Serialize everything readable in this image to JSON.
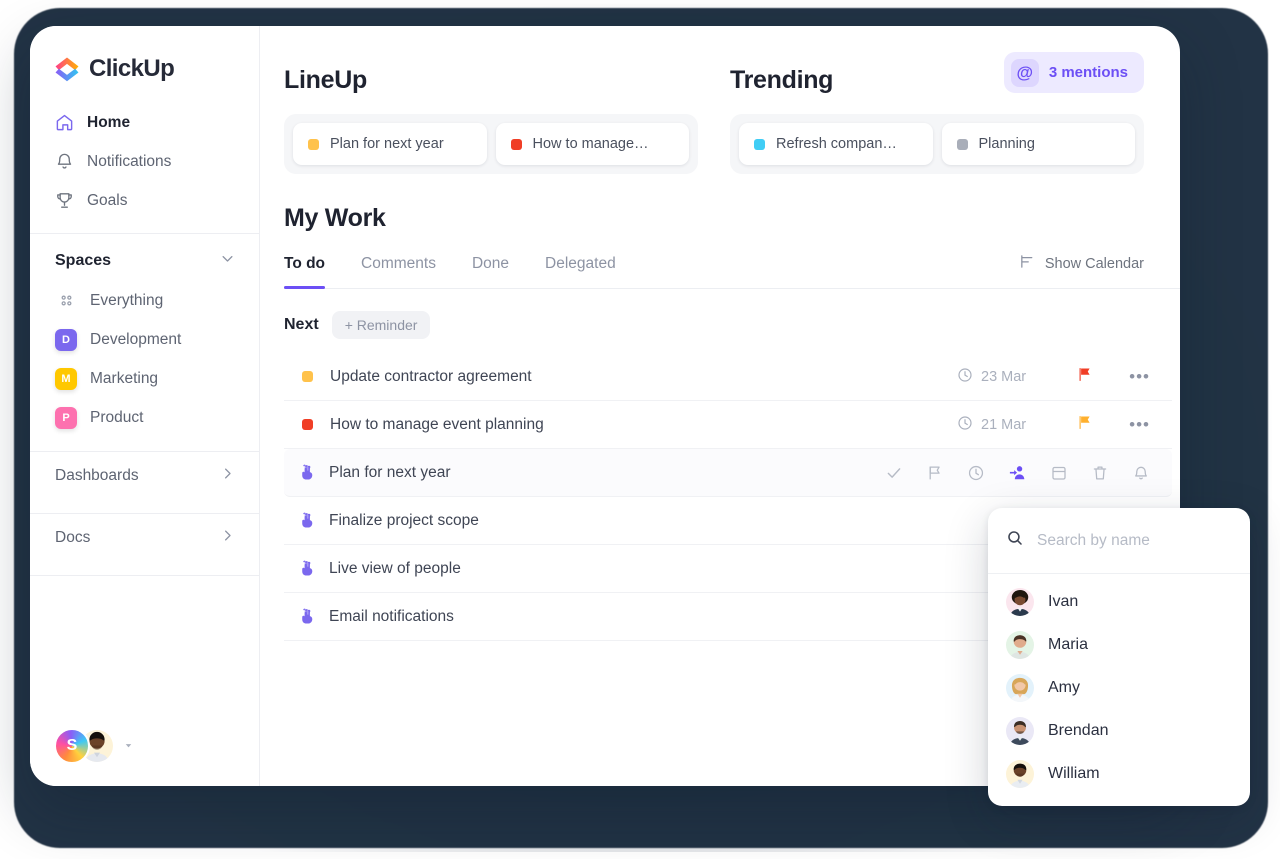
{
  "sidebar": {
    "brand": "ClickUp",
    "nav": [
      {
        "label": "Home",
        "icon": "home-icon",
        "active": true
      },
      {
        "label": "Notifications",
        "icon": "bell-icon",
        "active": false
      },
      {
        "label": "Goals",
        "icon": "trophy-icon",
        "active": false
      }
    ],
    "spaces_title": "Spaces",
    "spaces": [
      {
        "label": "Everything",
        "badge": "",
        "color": "",
        "icon": "grid-icon"
      },
      {
        "label": "Development",
        "badge": "D",
        "color": "#7b68ee"
      },
      {
        "label": "Marketing",
        "badge": "M",
        "color": "#ffc800"
      },
      {
        "label": "Product",
        "badge": "P",
        "color": "#fd71af"
      }
    ],
    "footer": [
      {
        "label": "Dashboards",
        "icon": "chevron-right-icon"
      },
      {
        "label": "Docs",
        "icon": "chevron-right-icon"
      }
    ],
    "user": {
      "initial": "S"
    }
  },
  "lineup": {
    "title": "LineUp",
    "items": [
      {
        "label": "Plan for next year",
        "color": "#ffc24b"
      },
      {
        "label": "How to manage…",
        "color": "#f03e26"
      }
    ]
  },
  "trending": {
    "title": "Trending",
    "items": [
      {
        "label": "Refresh compan…",
        "color": "#40cdf5"
      },
      {
        "label": "Planning",
        "color": "#a9aeb9"
      }
    ]
  },
  "mentions": {
    "icon": "at-icon",
    "label": "3 mentions",
    "color": "#6c4ff5"
  },
  "my_work": {
    "title": "My Work",
    "tabs": [
      {
        "label": "To do",
        "active": true
      },
      {
        "label": "Comments",
        "active": false
      },
      {
        "label": "Done",
        "active": false
      },
      {
        "label": "Delegated",
        "active": false
      }
    ],
    "show_calendar": {
      "label": "Show Calendar",
      "icon": "calendar-toggle-icon"
    },
    "group_label": "Next",
    "reminder_button": "+ Reminder",
    "tasks": [
      {
        "name": "Update contractor agreement",
        "marker": "square",
        "color": "#ffc24b",
        "due": "23 Mar",
        "due_icon": "clock-icon",
        "flag": "flag-icon",
        "flag_color": "#f03e26",
        "more": "•••",
        "hover": false
      },
      {
        "name": "How to manage event planning",
        "marker": "square",
        "color": "#f03e26",
        "due": "21 Mar",
        "due_icon": "clock-icon",
        "flag": "flag-icon",
        "flag_color": "#ffb02e",
        "more": "•••",
        "hover": false
      },
      {
        "name": "Plan for next year",
        "marker": "hand",
        "color": "#7b68ee",
        "due": "",
        "flag": "",
        "hover": true,
        "actions": [
          {
            "icon": "check-icon",
            "active": false
          },
          {
            "icon": "flag-icon",
            "active": false
          },
          {
            "icon": "clock-icon",
            "active": false
          },
          {
            "icon": "add-person-icon",
            "active": true
          },
          {
            "icon": "calendar-icon",
            "active": false
          },
          {
            "icon": "trash-icon",
            "active": false
          },
          {
            "icon": "bell-icon",
            "active": false
          }
        ]
      },
      {
        "name": "Finalize project scope",
        "marker": "hand",
        "color": "#7b68ee",
        "due": "",
        "flag": "",
        "hover": false
      },
      {
        "name": "Live view of people",
        "marker": "hand",
        "color": "#7b68ee",
        "due": "",
        "flag": "",
        "hover": false
      },
      {
        "name": "Email notifications",
        "marker": "hand",
        "color": "#7b68ee",
        "due": "",
        "flag": "",
        "hover": false
      }
    ]
  },
  "people_popover": {
    "search": {
      "placeholder": "Search by name",
      "value": "",
      "icon": "search-icon"
    },
    "people": [
      {
        "name": "Ivan",
        "tint": "#fbe6ee",
        "skin": "#7a4a32",
        "hair": "#20160f"
      },
      {
        "name": "Maria",
        "tint": "#e4f4e6",
        "skin": "#e0ab8c",
        "hair": "#4a3326"
      },
      {
        "name": "Amy",
        "tint": "#e3f2fb",
        "skin": "#f2c8a8",
        "hair": "#d8a659"
      },
      {
        "name": "Brendan",
        "tint": "#eae8f6",
        "skin": "#c99273",
        "hair": "#3b2d25"
      },
      {
        "name": "William",
        "tint": "#fdf3d8",
        "skin": "#6b4228",
        "hair": "#16100b"
      }
    ]
  }
}
